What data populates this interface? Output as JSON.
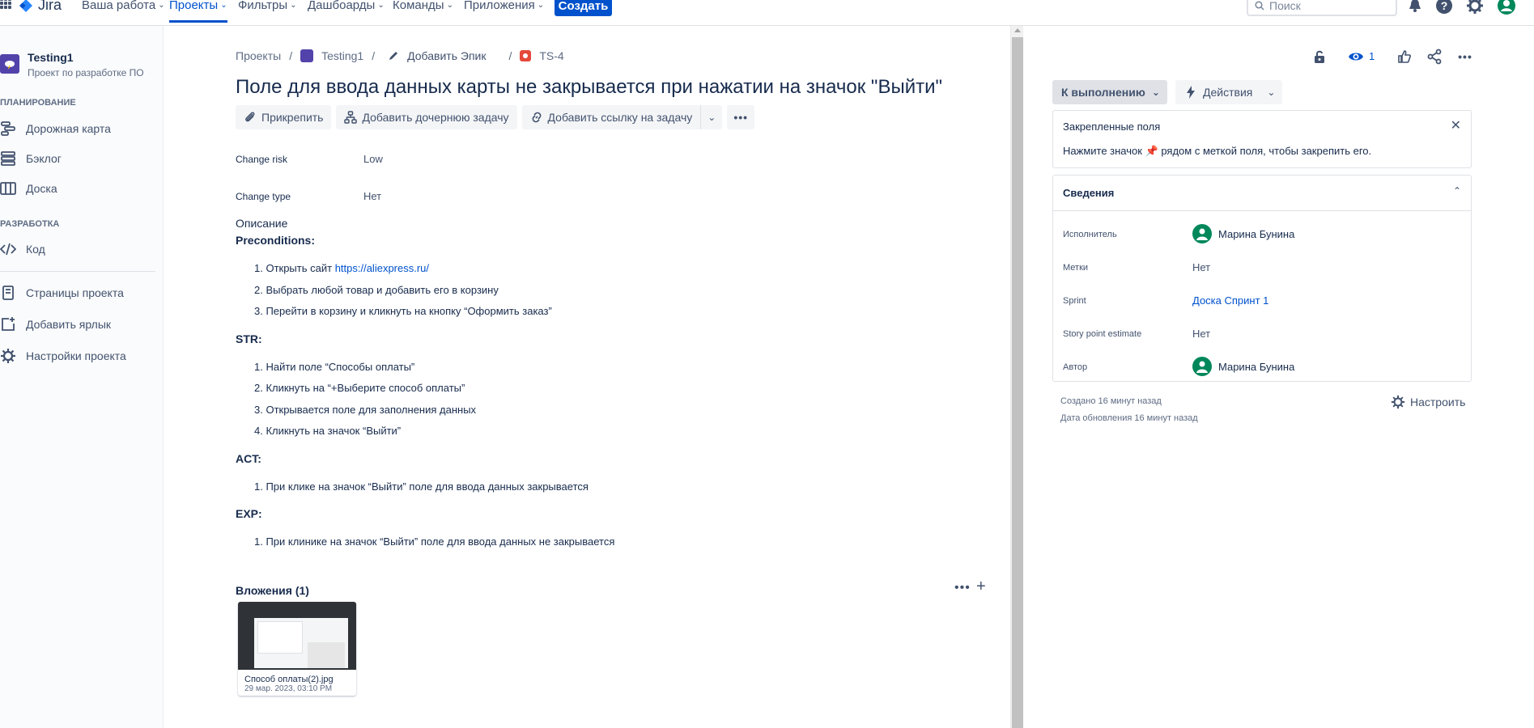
{
  "topnav": {
    "logo": "Jira",
    "items": [
      {
        "label": "Ваша работа"
      },
      {
        "label": "Проекты"
      },
      {
        "label": "Фильтры"
      },
      {
        "label": "Дашбоарды"
      },
      {
        "label": "Команды"
      },
      {
        "label": "Приложения"
      }
    ],
    "create_label": "Создать",
    "search_placeholder": "Поиск"
  },
  "sidebar": {
    "project_name": "Testing1",
    "project_type": "Проект по разработке ПО",
    "planning_label": "ПЛАНИРОВАНИЕ",
    "dev_label": "РАЗРАБОТКА",
    "items": {
      "roadmap": "Дорожная карта",
      "backlog": "Бэклог",
      "board": "Доска",
      "code": "Код",
      "pages": "Страницы проекта",
      "shortcut": "Добавить ярлык",
      "settings": "Настройки проекта"
    }
  },
  "breadcrumb": {
    "projects": "Проекты",
    "project": "Testing1",
    "epic": "Добавить Эпик",
    "issue_key": "TS-4"
  },
  "issue": {
    "title": "Поле для ввода данных карты не закрывается при нажатии на значок \"Выйти\"",
    "toolbar": {
      "attach": "Прикрепить",
      "child": "Добавить дочернюю задачу",
      "link": "Добавить ссылку на задачу"
    },
    "fields": {
      "change_risk_label": "Change risk",
      "change_risk_value": "Low",
      "change_type_label": "Change type",
      "change_type_value": "Нет"
    },
    "description": {
      "heading": "Описание",
      "pre_title": "Preconditions:",
      "pre": {
        "item1_prefix": "1. Открыть сайт ",
        "item1_link": "https://aliexpress.ru/",
        "item2": "2. Выбрать любой товар и добавить его в корзину",
        "item3": "3. Перейти в корзину и кликнуть на кнопку “Оформить заказ”"
      },
      "str_title": "STR:",
      "str": {
        "item1": "1. Найти поле “Способы оплаты”",
        "item2": "2. Кликнуть на “+Выберите способ оплаты”",
        "item3": "3. Открывается поле для заполнения данных",
        "item4": "4. Кликнуть на значок “Выйти”"
      },
      "act_title": "ACT:",
      "act": {
        "item1": "1. При клике на значок “Выйти” поле для ввода данных закрывается"
      },
      "exp_title": "EXP:",
      "exp": {
        "item1": "1. При клинике на значок “Выйти” поле для ввода данных не закрывается"
      }
    },
    "attachments": {
      "heading": "Вложения (1)",
      "file_name": "Способ оплаты(2).jpg",
      "file_date": "29 мар. 2023, 03:10 PM"
    }
  },
  "right_panel": {
    "watch_count": "1",
    "status": "К выполнению",
    "actions": "Действия",
    "pinned": {
      "title": "Закрепленные поля",
      "text": "Нажмите значок 📌 рядом с меткой поля, чтобы закрепить его."
    },
    "details": {
      "title": "Сведения",
      "assignee_label": "Исполнитель",
      "assignee": "Марина Бунина",
      "labels_label": "Метки",
      "labels": "Нет",
      "sprint_label": "Sprint",
      "sprint": "Доска Спринт 1",
      "story_label": "Story point estimate",
      "story": "Нет",
      "reporter_label": "Автор",
      "reporter": "Марина Бунина"
    },
    "created": "Создано 16 минут назад",
    "updated": "Дата обновления 16 минут назад",
    "configure": "Настроить"
  },
  "colors": {
    "primary": "#0052cc",
    "text": "#172b4d",
    "subtle": "#42526e",
    "avatar_green": "#00875a",
    "issue_red": "#e5493a"
  }
}
